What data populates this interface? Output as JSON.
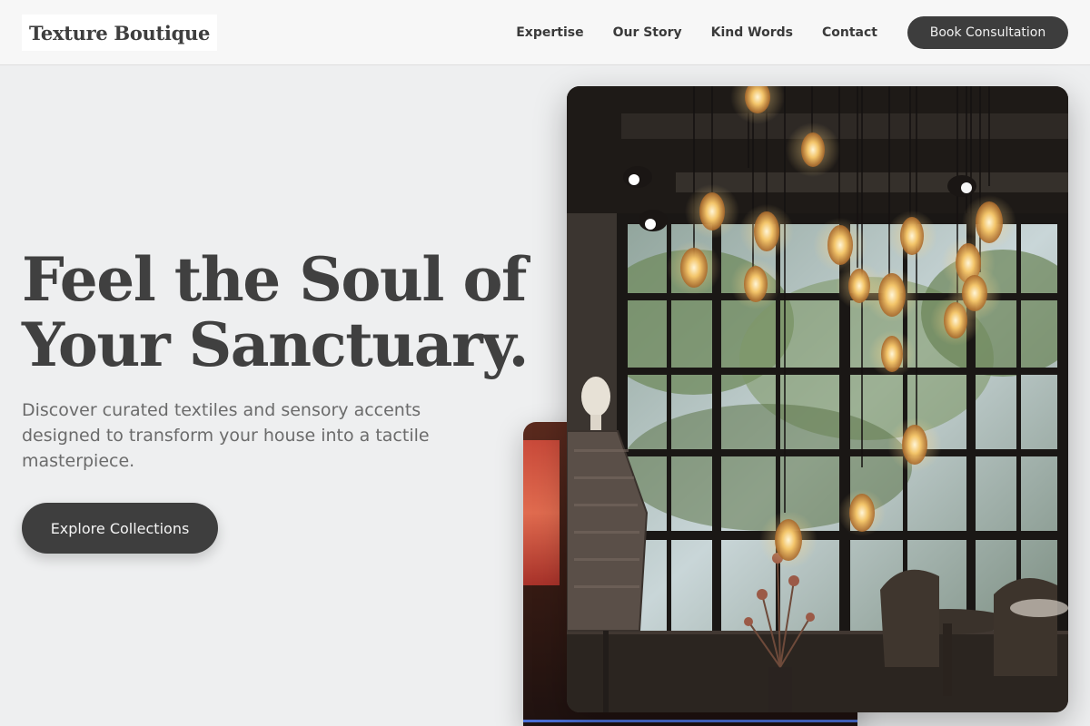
{
  "brand": {
    "name": "Texture Boutique"
  },
  "nav": {
    "links": [
      {
        "label": "Expertise"
      },
      {
        "label": "Our Story"
      },
      {
        "label": "Kind Words"
      },
      {
        "label": "Contact"
      }
    ],
    "cta_label": "Book Consultation"
  },
  "hero": {
    "title_line1": "Feel the Soul of",
    "title_line2": "Your Sanctuary.",
    "subtitle": "Discover curated textiles and sensory accents designed to transform your house into a tactile masterpiece.",
    "cta_label": "Explore Collections"
  },
  "images": {
    "main": {
      "description": "boutique-interior-with-pendant-bulbs-and-mannequin"
    },
    "back": {
      "description": "boutique-interior-detail"
    }
  },
  "colors": {
    "background": "#eeeff0",
    "nav_background": "#f7f7f7",
    "button": "#3e3e3e",
    "heading": "#404040",
    "body_text": "#6b6b6b"
  }
}
